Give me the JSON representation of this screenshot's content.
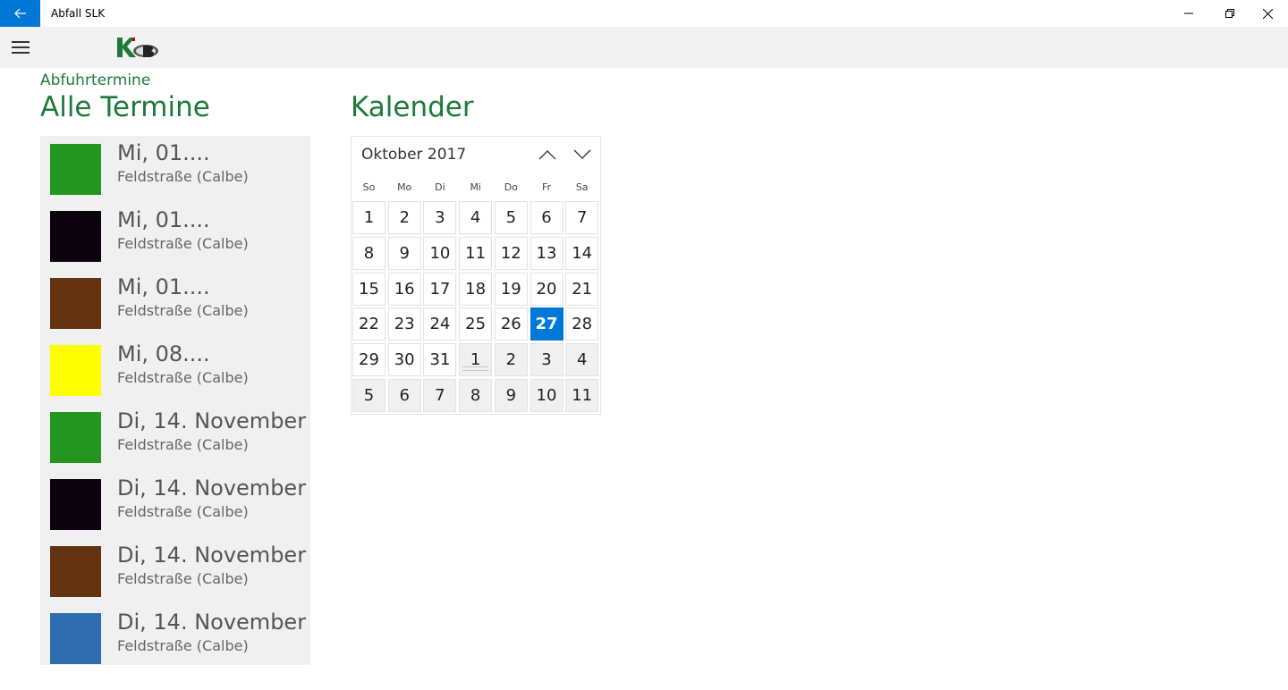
{
  "window": {
    "title": "Abfall SLK"
  },
  "header": {
    "subtitle": "Abfuhrtermine",
    "title": "Alle Termine"
  },
  "appointments": [
    {
      "date": "Mi, 01....",
      "place": "Feldstraße (Calbe)",
      "color": "#22961e"
    },
    {
      "date": "Mi, 01....",
      "place": "Feldstraße (Calbe)",
      "color": "#0c030e"
    },
    {
      "date": "Mi, 01....",
      "place": "Feldstraße (Calbe)",
      "color": "#643310"
    },
    {
      "date": "Mi, 08....",
      "place": "Feldstraße (Calbe)",
      "color": "#ffff00"
    },
    {
      "date": "Di, 14. November",
      "place": "Feldstraße (Calbe)",
      "color": "#22961e"
    },
    {
      "date": "Di, 14. November",
      "place": "Feldstraße (Calbe)",
      "color": "#0c030e"
    },
    {
      "date": "Di, 14. November",
      "place": "Feldstraße (Calbe)",
      "color": "#643310"
    },
    {
      "date": "Di, 14. November",
      "place": "Feldstraße (Calbe)",
      "color": "#2f6db0"
    }
  ],
  "calendar": {
    "title": "Kalender",
    "month_label": "Oktober 2017",
    "weekdays": [
      "So",
      "Mo",
      "Di",
      "Mi",
      "Do",
      "Fr",
      "Sa"
    ],
    "days": [
      [
        "1",
        "2",
        "3",
        "4",
        "5",
        "6",
        "7"
      ],
      [
        "8",
        "9",
        "10",
        "11",
        "12",
        "13",
        "14"
      ],
      [
        "15",
        "16",
        "17",
        "18",
        "19",
        "20",
        "21"
      ],
      [
        "22",
        "23",
        "24",
        "25",
        "26",
        "27",
        "28"
      ],
      [
        "29",
        "30",
        "31",
        "1",
        "2",
        "3",
        "4"
      ],
      [
        "5",
        "6",
        "7",
        "8",
        "9",
        "10",
        "11"
      ]
    ],
    "selected_day": "27",
    "accent_color": "#0078d7"
  },
  "icons": {
    "back": "back-arrow-icon",
    "menu": "hamburger-icon",
    "up": "chevron-up-icon",
    "down": "chevron-down-icon"
  }
}
